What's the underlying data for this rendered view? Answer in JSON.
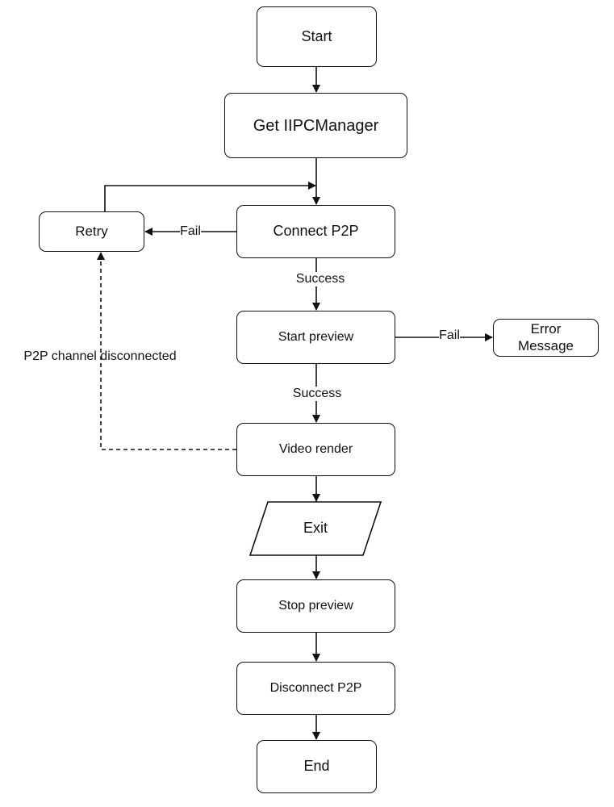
{
  "nodes": {
    "start": "Start",
    "get_manager": "Get IIPCManager",
    "connect": "Connect P2P",
    "retry": "Retry",
    "start_preview": "Start preview",
    "error": "Error Message",
    "video_render": "Video render",
    "exit": "Exit",
    "stop_preview": "Stop preview",
    "disconnect": "Disconnect P2P",
    "end": "End"
  },
  "edge_labels": {
    "connect_fail": "Fail",
    "connect_success": "Success",
    "preview_fail": "Fail",
    "preview_success": "Success",
    "channel_disconnected": "P2P channel disconnected"
  }
}
